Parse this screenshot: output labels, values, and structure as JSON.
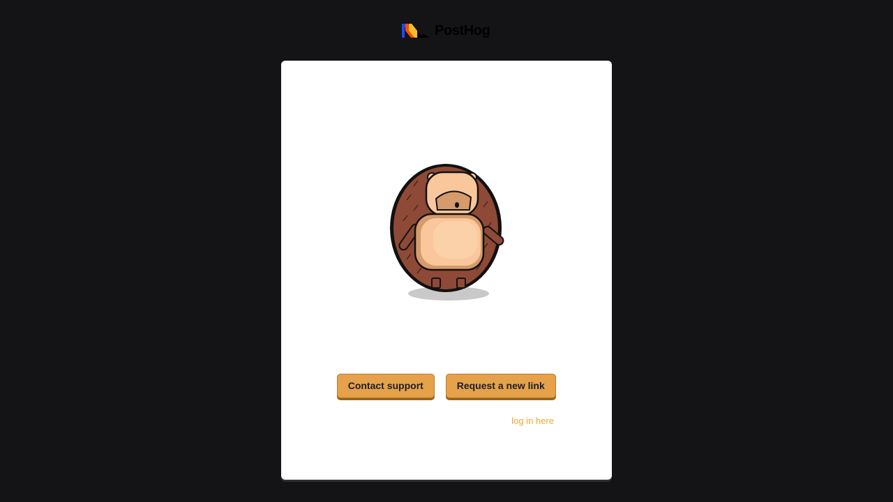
{
  "header": {
    "brand_name": "PostHog",
    "logo_icon": "posthog-logo-icon"
  },
  "illustration": {
    "icon": "hedgehog-holding-pillow-illustration"
  },
  "actions": {
    "contact_support_label": "Contact support",
    "request_link_label": "Request a new link"
  },
  "footer": {
    "login_link_label": "log in here"
  },
  "colors": {
    "background": "#141416",
    "card": "#ffffff",
    "button": "#e5a24b",
    "link": "#f1a82c"
  }
}
